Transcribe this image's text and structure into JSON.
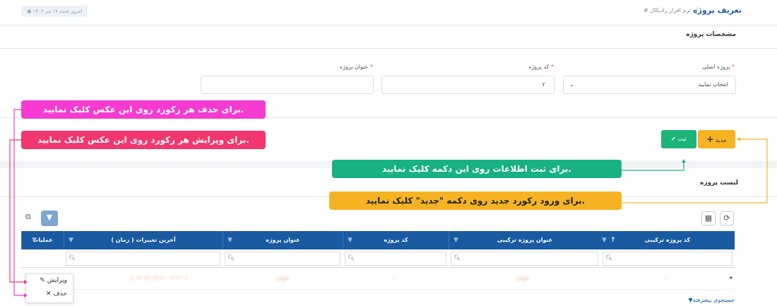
{
  "header": {
    "title": "تعریف پروژه",
    "breadcrumb": "# نرم افزار رادیکال",
    "date_badge": "امروز شنبه ۱۷ تیر ۱۴۰۲"
  },
  "form": {
    "section_title": "مشخصات پروژه",
    "fields": [
      {
        "label": "پروژه اصلی",
        "required": "*",
        "value": "انتخاب نمایید"
      },
      {
        "label": "کد پروژه",
        "required": "*",
        "value": "۲"
      },
      {
        "label": "عنوان پروژه",
        "required": "*",
        "value": ""
      }
    ]
  },
  "toolbar": {
    "new_label": "جدید",
    "save_label": "ثبت"
  },
  "list": {
    "title": "لیست پروژه",
    "columns": [
      "کد پروژه ترکیبی",
      "عنوان پروژه ترکیبی",
      "کد پروژه",
      "عنوان پروژه",
      "آخرین تغییرات ( زمان )",
      "عملیات"
    ],
    "row": [
      "۱",
      "عنوان",
      "۱",
      "عنوان",
      "[ ۱۴۰۲/۰۴/۱۷ - ۱۲:۳۰ ]"
    ],
    "advanced_search": "جستجوی پیشرفته"
  },
  "context_menu": {
    "edit": "ویرایش",
    "delete": "حذف"
  },
  "callouts": {
    "delete": "برای حذف هر رکورد روی این عکس کلیک نمایید.",
    "edit": "برای ویرایش هر رکورد روی این عکس کلیک نمایید.",
    "save": "برای ثبت اطلاعات روی این دکمه کلیک نمایید.",
    "new": "برای ورود رکورد جدید روی دکمه \"جدید\" کلیک نمایید."
  },
  "colors": {
    "primary": "#1a5aa0",
    "new_button": "#f5b324",
    "save_button": "#1db47a",
    "callout_delete": "#f53bd2",
    "callout_edit": "#f2366f",
    "callout_save": "#17b184",
    "callout_new": "#f5b324"
  }
}
